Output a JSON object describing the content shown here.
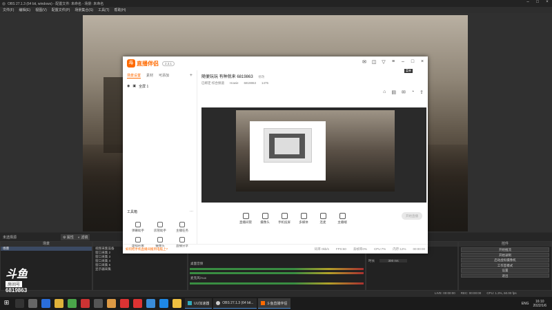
{
  "obs": {
    "title": "OBS 27.1.3 (64 bit, windows) - 配置文件: 未命名 - 场景: 未命名",
    "menu": [
      "文件(F)",
      "编辑(E)",
      "视图(V)",
      "配置文件(P)",
      "场景集合(S)",
      "工具(T)",
      "帮助(H)"
    ],
    "scene_label": "未选择源",
    "props_btn": "属性",
    "filters_btn": "滤镜",
    "panels": {
      "scenes": {
        "title": "场景",
        "items": [
          "场景"
        ]
      },
      "sources": {
        "title": "来源",
        "items": [
          "视频采集设备",
          "窗口采集 2",
          "窗口采集 3",
          "窗口采集 4",
          "窗口采集 5",
          "显示器采集"
        ]
      },
      "mixer": {
        "title": "",
        "channel1": "桌面音频",
        "channel2": "麦克风/Aux"
      },
      "transitions": {
        "title": "",
        "duration_label": "时长",
        "duration_value": "300 ms"
      },
      "controls": {
        "title": "控件",
        "buttons": [
          "开始推流",
          "开始录制",
          "启动虚拟摄像机",
          "工作室模式",
          "设置",
          "退出"
        ]
      }
    },
    "status": {
      "live": "LIVE: 00:00:00",
      "rec": "REC: 00:00:00",
      "cpu": "CPU: 1.3%, 60.00 fps"
    }
  },
  "douyu_overlay": {
    "brand": "斗鱼",
    "sub": "房间号",
    "room": "6819863"
  },
  "dy": {
    "brand": "直播伴侣",
    "version": "2.3.1",
    "tabs": [
      "场景设置",
      "素材",
      "可添加"
    ],
    "scene_item": "全屏 1",
    "tools_header": "工具箱",
    "tools": [
      "弹幕助手",
      "房管助手",
      "主播任务",
      "虚拟形象",
      "摄像头",
      "直播分享"
    ],
    "room_title": "随便玩玩 有种就来 6819863",
    "room_edit": "修改",
    "meta": [
      "已绑定·综合频道",
      "Howie",
      "6819863",
      "1475"
    ],
    "toolbar": [
      "直播间管",
      "摄像头",
      "手机投屏",
      "多媒体",
      "连麦",
      "主播端"
    ],
    "start": "开始直播",
    "status_line": "如何把手机直播间搬到电脑上?",
    "stats": [
      "码率 0kb/s",
      "FPS:60",
      "丢帧率0%",
      "CPU:7%",
      "内存:12%",
      "00:00:00"
    ],
    "tooltip": "菜单"
  },
  "taskbar": {
    "apps": [
      "UU加速器",
      "OBS 27.1.3 (64 bit...",
      "斗鱼直播伴侣"
    ],
    "tray": [
      "ENG"
    ],
    "time": "16:10",
    "date": "2022/1/6"
  }
}
